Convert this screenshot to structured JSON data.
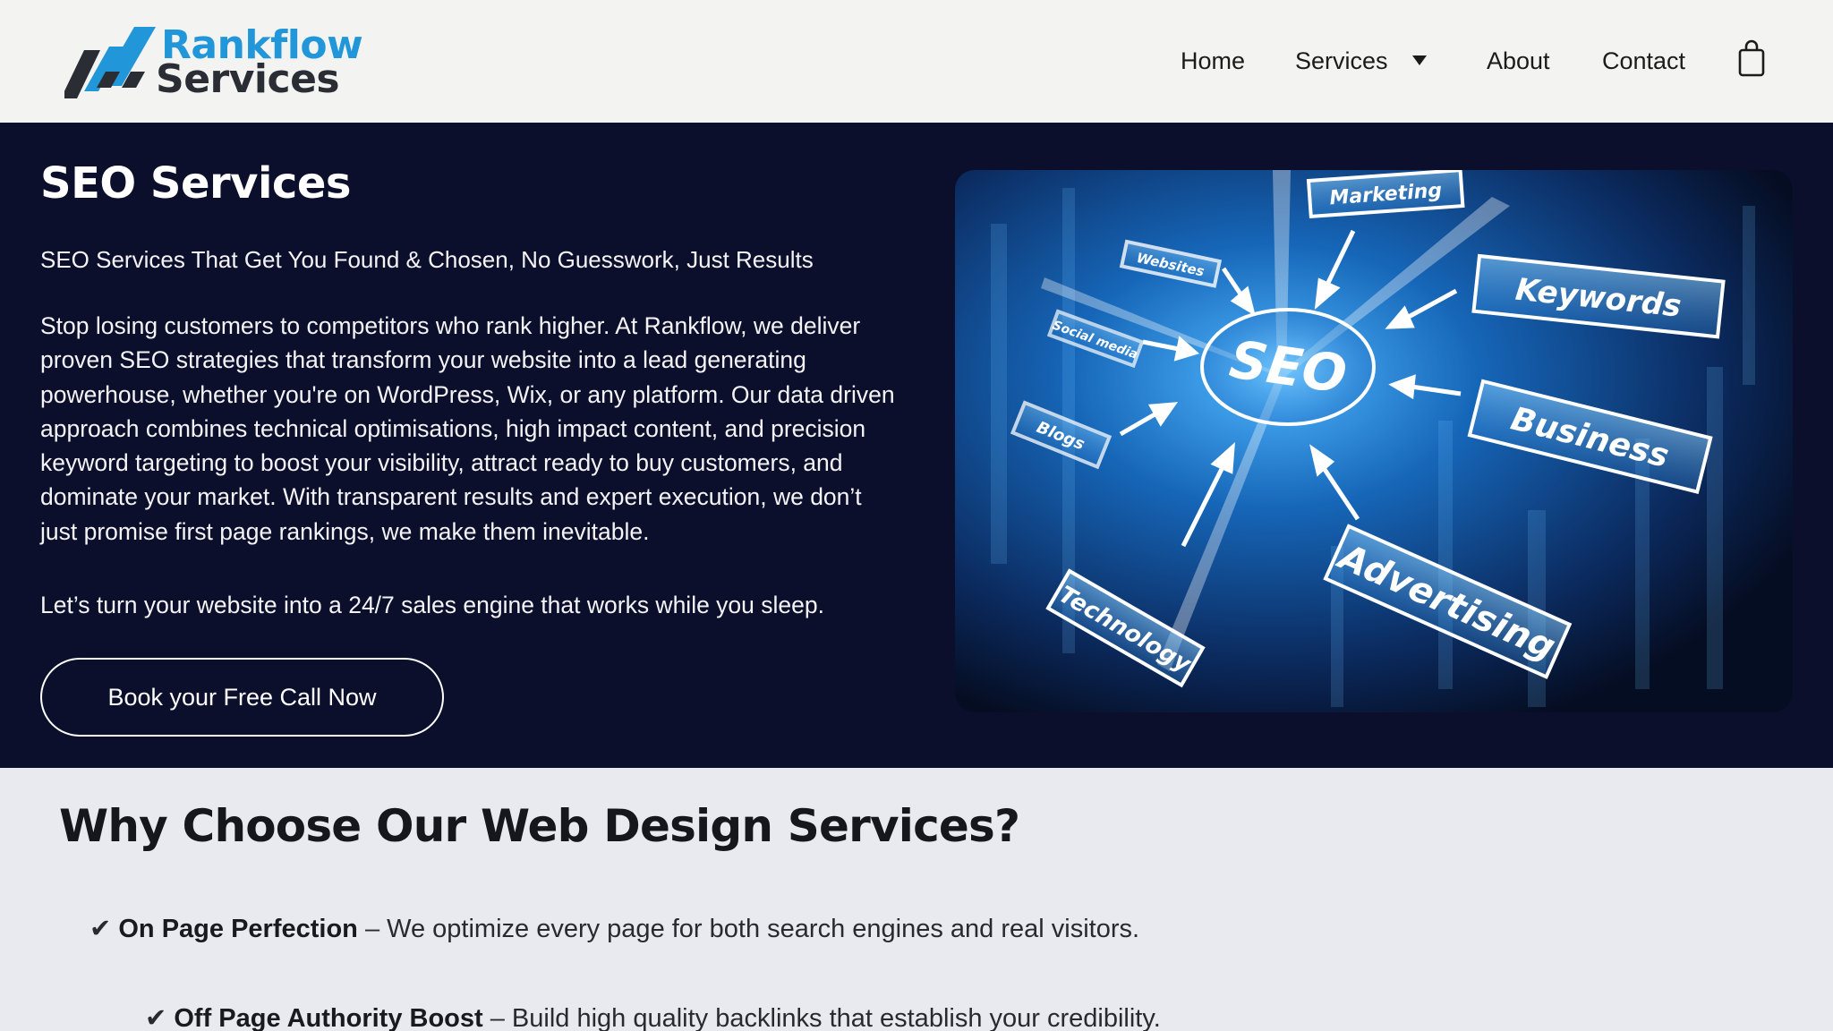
{
  "brand": {
    "name_line1": "Rankflow",
    "name_line2": "Services"
  },
  "nav": {
    "home": "Home",
    "services": "Services",
    "about": "About",
    "contact": "Contact"
  },
  "icons": {
    "cart": "shopping-bag-icon",
    "services_dropdown": "caret-down-icon",
    "logo_mark": "slash-stripes-icon"
  },
  "colors": {
    "brand_blue": "#2196d8",
    "hero_bg": "#0c0f2c",
    "header_bg": "#f3f3f2",
    "section_bg": "#e8eaef"
  },
  "hero": {
    "title": "SEO Services",
    "subtitle": "SEO Services That Get You Found & Chosen, No Guesswork, Just Results",
    "body": "Stop losing customers to competitors who rank higher. At Rankflow, we deliver proven SEO strategies that transform your website into a lead generating powerhouse, whether you're on WordPress, Wix, or any platform. Our data driven approach combines technical optimisations, high impact content, and precision keyword targeting to boost your visibility, attract ready to buy customers, and dominate your market. With transparent results and expert execution, we don’t just promise first page rankings, we make them inevitable.",
    "closing": "Let’s turn your website into a 24/7 sales engine that works while you sleep.",
    "cta": "Book your Free Call Now",
    "image": {
      "center_label": "SEO",
      "labels": [
        "Marketing",
        "Websites",
        "Social media",
        "Blogs",
        "Keywords",
        "Business",
        "Technology",
        "Advertising"
      ]
    }
  },
  "why": {
    "title": "Why Choose Our Web Design Services?",
    "items": [
      {
        "check": "✔",
        "heading": "On Page Perfection",
        "text": " – We optimize every page for both search engines and real visitors."
      },
      {
        "check": "✔",
        "heading": "Off Page Authority Boost",
        "text": " – Build high quality backlinks that establish your credibility."
      }
    ]
  }
}
